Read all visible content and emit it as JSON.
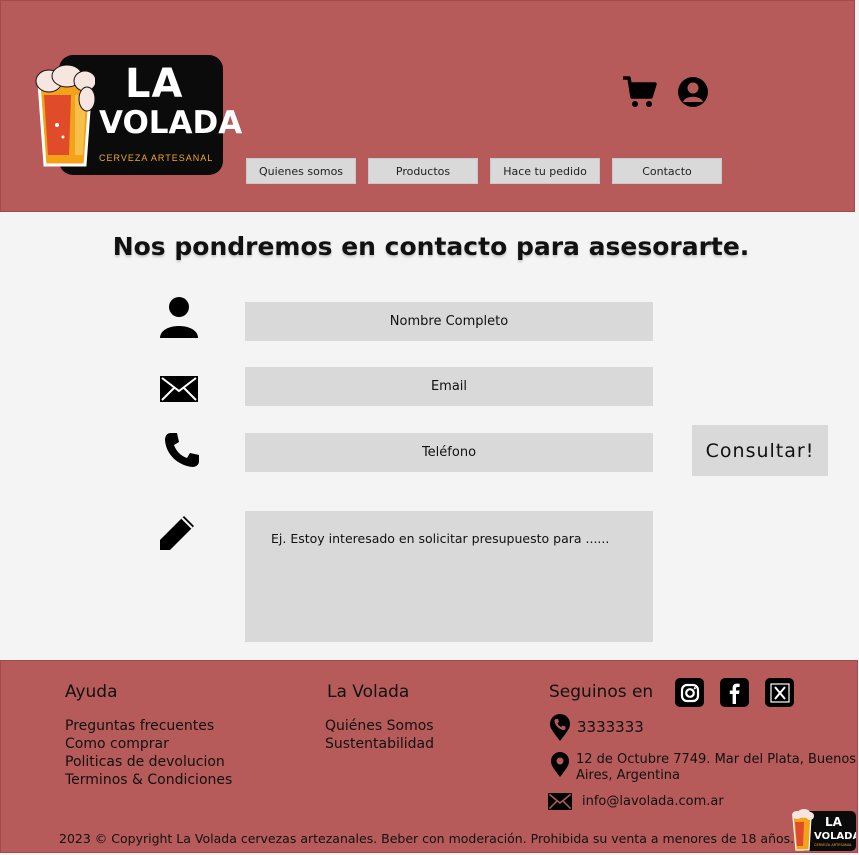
{
  "brand": {
    "name_line1": "LA",
    "name_line2": "VOLADA",
    "tagline": "CERVEZA ARTESANAL"
  },
  "header_icons": [
    "cart-icon",
    "user-account-icon"
  ],
  "nav": {
    "items": [
      {
        "label": "Quienes somos"
      },
      {
        "label": "Productos"
      },
      {
        "label": "Hace tu pedido"
      },
      {
        "label": "Contacto"
      }
    ]
  },
  "main": {
    "title": "Nos pondremos en contacto para asesorarte.",
    "fields": {
      "name_placeholder": "Nombre Completo",
      "email_placeholder": "Email",
      "phone_placeholder": "Teléfono",
      "message_placeholder": "Ej. Estoy interesado en solicitar presupuesto para ......"
    },
    "submit_label": "Consultar!"
  },
  "footer": {
    "help": {
      "title": "Ayuda",
      "links": [
        "Preguntas frecuentes",
        "Como comprar",
        "Politicas de devolucion",
        "Terminos & Condiciones"
      ]
    },
    "company": {
      "title": "La Volada",
      "links": [
        "Quiénes Somos",
        "Sustentabilidad"
      ]
    },
    "follow": {
      "title": "Seguinos en",
      "icons": [
        "instagram-icon",
        "facebook-icon",
        "x-twitter-icon"
      ]
    },
    "contact": {
      "phone": "3333333",
      "address_line1": "12 de Octubre 7749. Mar del Plata, Buenos",
      "address_line2": "Aires, Argentina",
      "email": "info@lavolada.com.ar"
    },
    "copyright": "2023 © Copyright La Volada cervezas artezanales. Beber con moderación. Prohibida su venta a menores de 18 años.",
    "mini_logo": {
      "line1": "LA",
      "line2": "VOLADA",
      "tagline": "CERVEZA ARTESANAL"
    }
  },
  "colors": {
    "header_bg": "#b65a5a",
    "page_bg": "#f4f4f4",
    "field_bg": "#d9d9d9",
    "accent": "#f1a82f"
  }
}
